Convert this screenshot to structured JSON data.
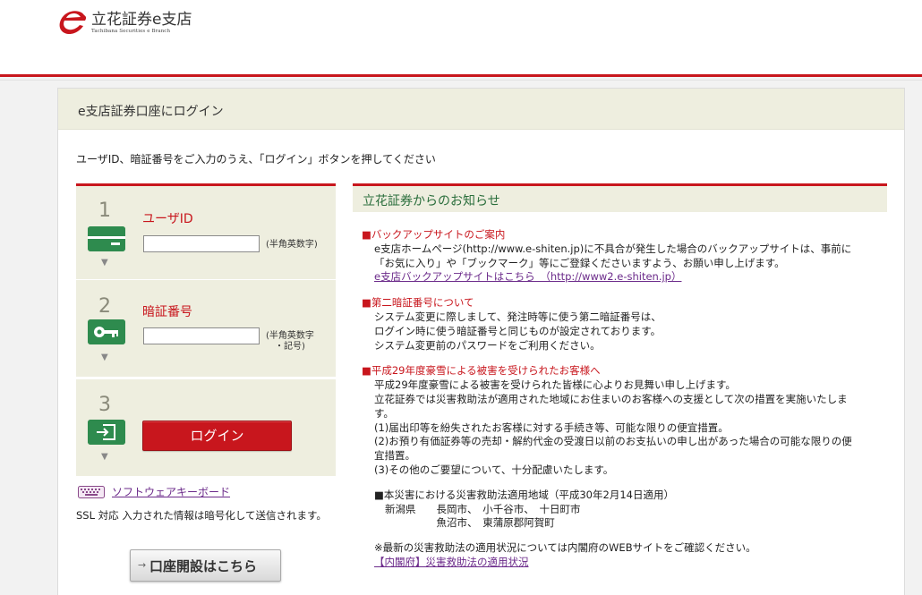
{
  "logo": {
    "title_prefix": "立花証券",
    "title_e": "e",
    "title_suffix": "支店",
    "subtitle": "Tachibana Securities e Branch"
  },
  "page": {
    "heading": "e支店証券口座にログイン",
    "instruction": "ユーザID、暗証番号をご入力のうえ、「ログイン」ボタンを押してください"
  },
  "login": {
    "step1": {
      "number": "1",
      "label": "ユーザID",
      "hint": "(半角英数字)",
      "value": ""
    },
    "step2": {
      "number": "2",
      "label": "暗証番号",
      "hint_line1": "(半角英数字",
      "hint_line2": "・記号)",
      "value": ""
    },
    "step3": {
      "number": "3",
      "button_label": "ログイン"
    },
    "arrow_glyph": "▼",
    "keyboard_link": "ソフトウェアキーボード",
    "ssl_note": "SSL 対応 入力された情報は暗号化して送信されます。",
    "open_account_arrow": "→",
    "open_account_button": "口座開設はこちら"
  },
  "news": {
    "title": "立花証券からのお知らせ",
    "sections": [
      {
        "title": "■バックアップサイトのご案内",
        "lines": [
          "e支店ホームページ(http://www.e-shiten.jp)に不具合が発生した場合のバックアップサイトは、事前に",
          "「お気に入り」や「ブックマーク」等にご登録くださいますよう、お願い申し上げます。"
        ],
        "link": "e支店バックアップサイトはこちら　（http://www2.e-shiten.jp）"
      },
      {
        "title": "■第二暗証番号について",
        "lines": [
          "システム変更に際しまして、発注時等に使う第二暗証番号は、",
          "ログイン時に使う暗証番号と同じものが設定されております。",
          "システム変更前のパスワードをご利用ください。"
        ]
      },
      {
        "title": "■平成29年度豪雪による被害を受けられたお客様へ",
        "lines": [
          "平成29年度豪雪による被害を受けられた皆様に心よりお見舞い申し上げます。",
          "立花証券では災害救助法が適用された地域にお住まいのお客様への支援として次の措置を実施いたしま",
          "す。",
          "(1)届出印等を紛失されたお客様に対する手続き等、可能な限りの便宜措置。",
          "(2)お預り有価証券等の売却・解約代金の受渡日以前のお支払いの申し出があった場合の可能な限りの便",
          "宜措置。",
          "(3)その他のご要望について、十分配慮いたします。"
        ],
        "area_title": "■本災害における災害救助法適用地域（平成30年2月14日適用）",
        "area_lines": [
          "新潟県　　長岡市、　小千谷市、　十日町市",
          "　　　　　魚沼市、　東蒲原郡阿賀町"
        ],
        "note": "※最新の災害救助法の適用状況については内閣府のWEBサイトをご確認ください。",
        "note_link": "【内閣府】災害救助法の適用状況"
      }
    ]
  }
}
